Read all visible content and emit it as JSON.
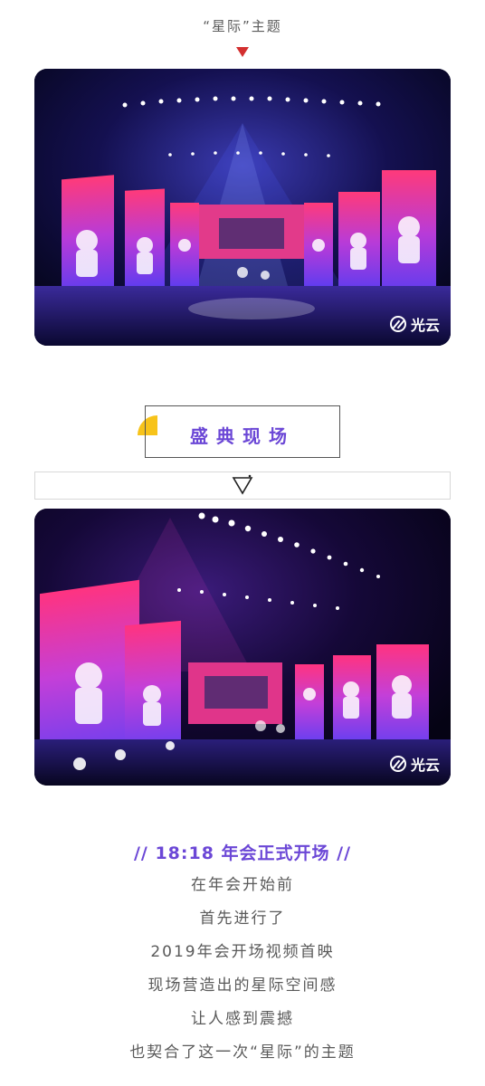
{
  "top_caption": "“星际”主题",
  "brand": "光云",
  "section_title": "盛典现场",
  "heading": "// 18:18 年会正式开场 //",
  "body_lines": [
    "在年会开始前",
    "首先进行了",
    "2019年会开场视频首映",
    "现场营造出的星际空间感",
    "让人感到震撼",
    "也契合了这一次“星际”的主题"
  ],
  "colors": {
    "accent_purple": "#6b47d6",
    "marker_red": "#d32f2f",
    "accent_yellow": "#f7c31a",
    "text_gray": "#5a5a5a"
  },
  "icons": [
    "down-triangle-icon",
    "brand-logo-icon",
    "yellow-quarter-icon"
  ]
}
